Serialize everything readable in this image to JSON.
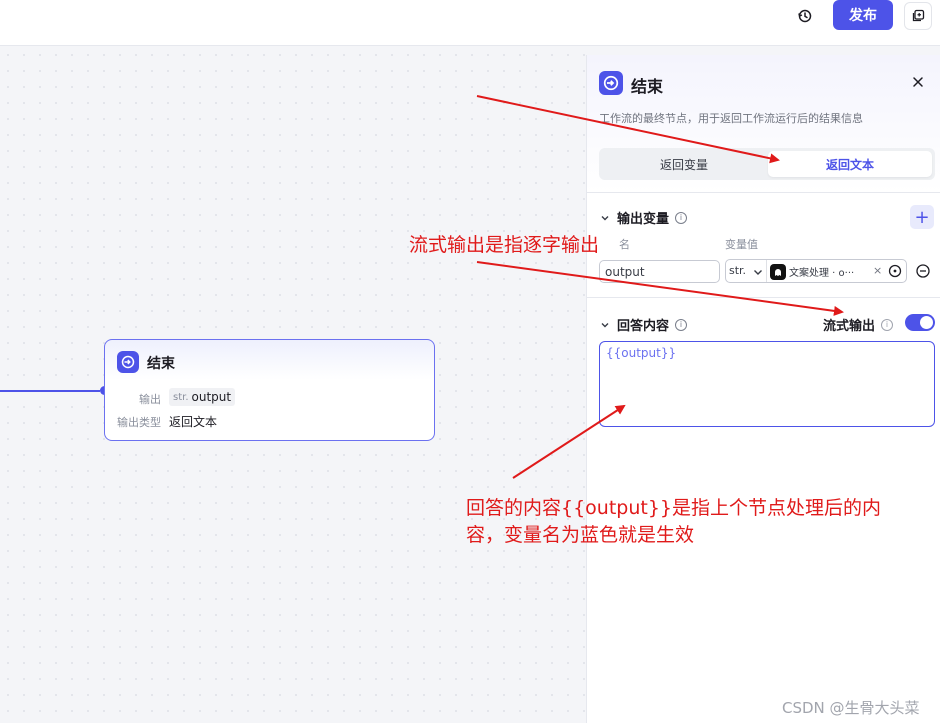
{
  "topbar": {
    "history_icon": "history-icon",
    "publish_label": "发布",
    "copy_icon": "copy-icon"
  },
  "canvas": {
    "node": {
      "title": "结束",
      "output_label": "输出",
      "output_type": "str.",
      "output_name": "output",
      "output_type_label": "输出类型",
      "output_type_value": "返回文本"
    }
  },
  "panel": {
    "title": "结束",
    "description": "工作流的最终节点，用于返回工作流运行后的结果信息",
    "tabs": [
      {
        "label": "返回变量",
        "active": false
      },
      {
        "label": "返回文本",
        "active": true
      }
    ],
    "output_vars": {
      "title": "输出变量",
      "col_name_partial": "名",
      "col_value": "变量值",
      "rows": [
        {
          "name": "output",
          "type": "str.",
          "ref_text": "文案处理 · o···",
          "remove_mark": "×"
        }
      ]
    },
    "answer": {
      "title": "回答内容",
      "stream_label": "流式输出",
      "stream_on": true,
      "content": "{{output}}"
    }
  },
  "annotations": {
    "stream_note": "流式输出是指逐字输出",
    "answer_note_line1": "回答的内容{{output}}是指上个节点处理后的内",
    "answer_note_line2": "容，变量名为蓝色就是生效"
  },
  "colors": {
    "accent": "#4d53e8",
    "annotation": "#e01a1a"
  },
  "watermark": "CSDN @生骨大头菜"
}
